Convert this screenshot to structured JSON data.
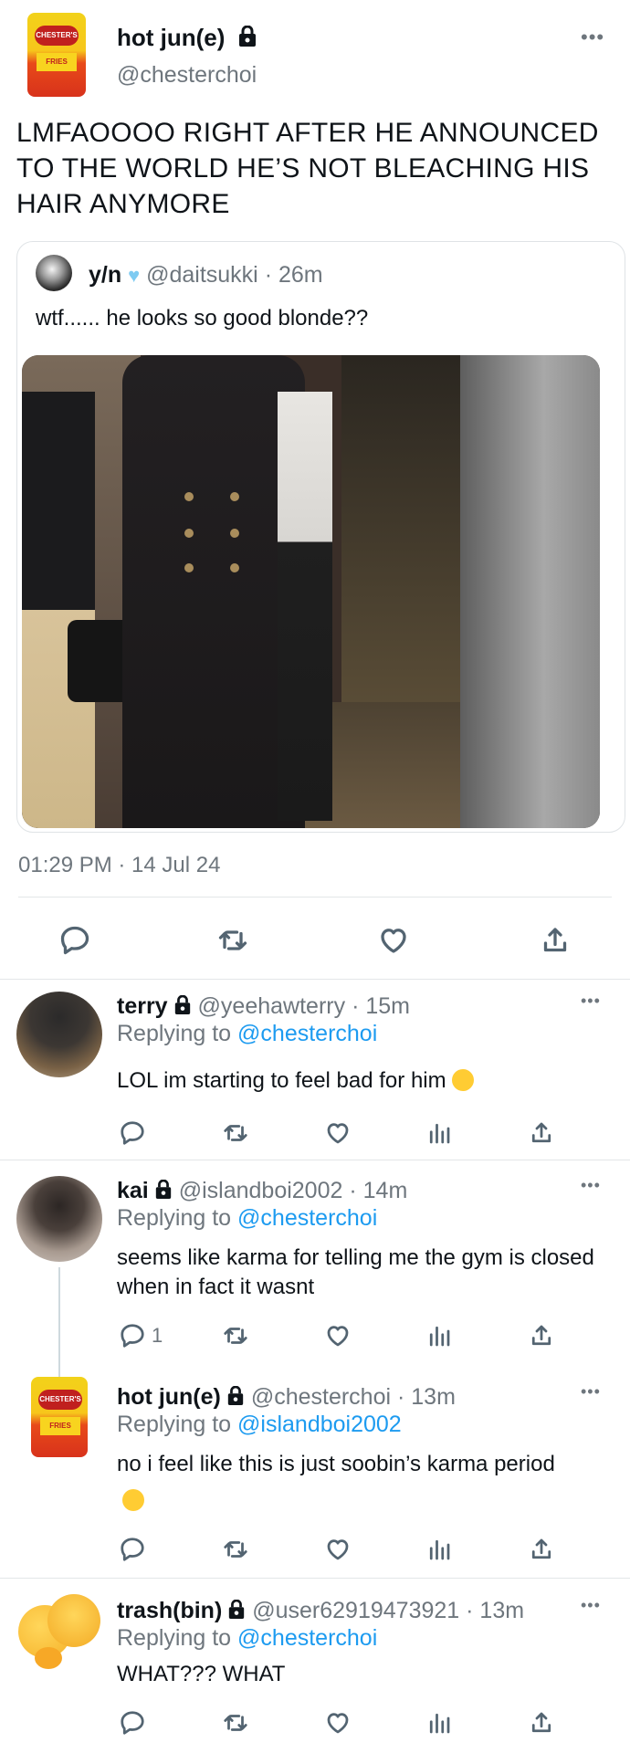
{
  "main_tweet": {
    "display_name": "hot jun(e)",
    "handle": "@chesterchoi",
    "text": "LMFAOOOO RIGHT AFTER HE ANNOUNCED TO THE WORLD HE’S NOT BLEACHING HIS HAIR ANYMORE",
    "avatar_label": "CHESTER'S",
    "avatar_sub": "FRIES",
    "quote": {
      "display_name": "y/n",
      "handle": "@daitsukki",
      "time": "26m",
      "text": "wtf...... he looks so good blonde??"
    },
    "timestamp": "01:29 PM · 14 Jul 24"
  },
  "replies": [
    {
      "display_name": "terry",
      "handle": "@yeehawterry",
      "time": "15m",
      "replying_prefix": "Replying to",
      "replying_to": "@chesterchoi",
      "text": "LOL im starting to feel bad for him",
      "reply_count": ""
    },
    {
      "display_name": "kai",
      "handle": "@islandboi2002",
      "time": "14m",
      "replying_prefix": "Replying to",
      "replying_to": "@chesterchoi",
      "text": "seems like karma for telling me the gym is closed when in fact it wasnt",
      "reply_count": "1"
    },
    {
      "display_name": "hot jun(e)",
      "handle": "@chesterchoi",
      "time": "13m",
      "replying_prefix": "Replying to",
      "replying_to": "@islandboi2002",
      "text": "no i feel like this is just soobin’s karma period",
      "reply_count": ""
    },
    {
      "display_name": "trash(bin)",
      "handle": "@user62919473921",
      "time": "13m",
      "replying_prefix": "Replying to",
      "replying_to": "@chesterchoi",
      "text": "WHAT??? WHAT",
      "reply_count": ""
    }
  ],
  "separator": "·",
  "icons": [
    "lock-icon",
    "more-icon",
    "reply-icon",
    "retweet-icon",
    "like-icon",
    "share-icon",
    "analytics-icon",
    "verified-heart-icon"
  ],
  "colors": {
    "link": "#1d9bf0",
    "muted": "#6e767d",
    "text": "#0f1419"
  }
}
